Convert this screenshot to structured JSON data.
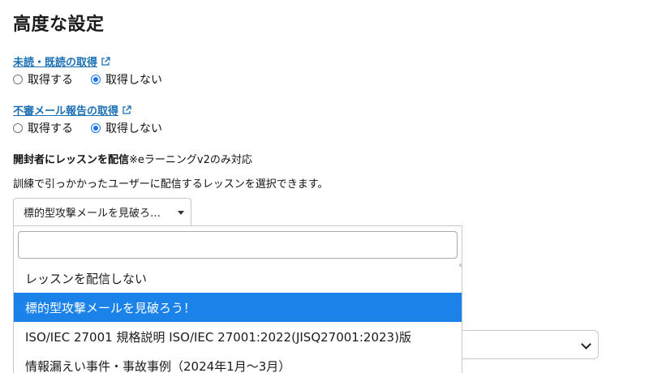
{
  "page": {
    "title": "高度な設定"
  },
  "read_status": {
    "heading": "未読・既読の取得",
    "options": [
      "取得する",
      "取得しない"
    ],
    "selected_index": 1
  },
  "suspicious_report": {
    "heading": "不審メール報告の取得",
    "options": [
      "取得する",
      "取得しない"
    ],
    "selected_index": 1
  },
  "lesson": {
    "label_bold": "開封者にレッスンを配信",
    "label_note": "※eラーニングv2のみ対応",
    "description": "訓練で引っかかったユーザーに配信するレッスンを選択できます。",
    "selected_display": "標的型攻撃メールを見破ろ…",
    "search_value": "",
    "options": [
      "レッスンを配信しない",
      "標的型攻撃メールを見破ろう！",
      "ISO/IEC 27001 規格説明 ISO/IEC 27001:2022(JISQ27001:2023)版",
      "情報漏えい事件・事故事例（2024年1月～3月）"
    ],
    "highlighted_index": 1
  },
  "colors": {
    "link": "#1a6fb5",
    "highlight": "#1b82ea",
    "radio_checked": "#1a73e8"
  }
}
